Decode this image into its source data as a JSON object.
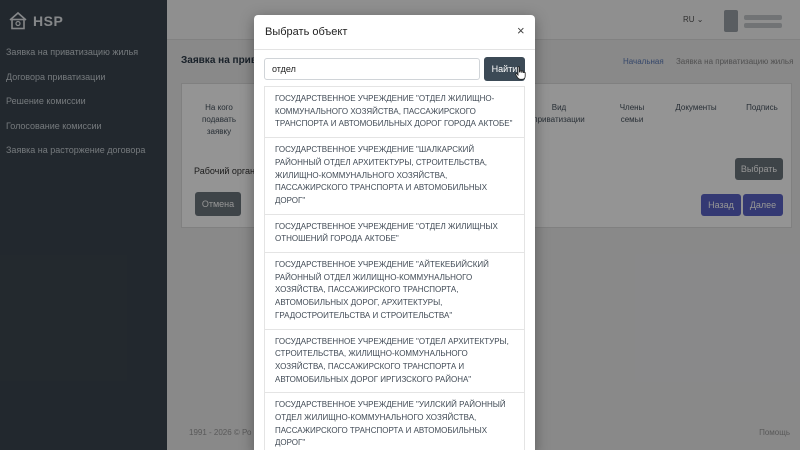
{
  "app": {
    "name": "HSP"
  },
  "sidebar": {
    "items": [
      {
        "label": "Заявка на приватизацию жилья"
      },
      {
        "label": "Договора приватизации"
      },
      {
        "label": "Решение комиссии"
      },
      {
        "label": "Голосование комиссии"
      },
      {
        "label": "Заявка на расторжение договора"
      }
    ]
  },
  "topbar": {
    "language": "RU"
  },
  "page": {
    "title": "Заявка на прива",
    "breadcrumb": {
      "home": "Начальная",
      "current": "Заявка на приватизацию жилья"
    },
    "columns": [
      {
        "label": "На кого подавать заявку"
      },
      {
        "label": "Вид приватизации"
      },
      {
        "label": "Члены семьи"
      },
      {
        "label": "Документы"
      },
      {
        "label": "Подпись"
      }
    ],
    "working_body_label": "Рабочий орган",
    "choose_label": "Выбрать",
    "cancel_label": "Отмена",
    "back_label": "Назад",
    "next_label": "Далее",
    "footer_left": "1991 - 2026 © Ро",
    "footer_right": "Помощь"
  },
  "modal": {
    "title": "Выбрать объект",
    "close_symbol": "×",
    "search": {
      "value": "отдел",
      "button_label": "Найти"
    },
    "results": [
      {
        "text": "ГОСУДАРСТВЕННОЕ УЧРЕЖДЕНИЕ \"ОТДЕЛ ЖИЛИЩНО-КОММУНАЛЬНОГО ХОЗЯЙСТВА, ПАССАЖИРСКОГО ТРАНСПОРТА И АВТОМОБИЛЬНЫХ ДОРОГ ГОРОДА АКТОБЕ\""
      },
      {
        "text": "ГОСУДАРСТВЕННОЕ УЧРЕЖДЕНИЕ \"ШАЛКАРСКИЙ РАЙОННЫЙ ОТДЕЛ АРХИТЕКТУРЫ, СТРОИТЕЛЬСТВА, ЖИЛИЩНО-КОММУНАЛЬНОГО ХОЗЯЙСТВА, ПАССАЖИРСКОГО ТРАНСПОРТА И АВТОМОБИЛЬНЫХ ДОРОГ\""
      },
      {
        "text": "ГОСУДАРСТВЕННОЕ УЧРЕЖДЕНИЕ \"ОТДЕЛ ЖИЛИЩНЫХ ОТНОШЕНИЙ ГОРОДА АКТОБЕ\""
      },
      {
        "text": "ГОСУДАРСТВЕННОЕ УЧРЕЖДЕНИЕ \"АЙТЕКЕБИЙСКИЙ РАЙОННЫЙ ОТДЕЛ ЖИЛИЩНО-КОММУНАЛЬНОГО ХОЗЯЙСТВА, ПАССАЖИРСКОГО ТРАНСПОРТА, АВТОМОБИЛЬНЫХ ДОРОГ, АРХИТЕКТУРЫ, ГРАДОСТРОИТЕЛЬСТВА И СТРОИТЕЛЬСТВА\""
      },
      {
        "text": "ГОСУДАРСТВЕННОЕ УЧРЕЖДЕНИЕ \"ОТДЕЛ АРХИТЕКТУРЫ, СТРОИТЕЛЬСТВА, ЖИЛИЩНО-КОММУНАЛЬНОГО ХОЗЯЙСТВА, ПАССАЖИРСКОГО ТРАНСПОРТА И АВТОМОБИЛЬНЫХ ДОРОГ ИРГИЗСКОГО РАЙОНА\""
      },
      {
        "text": "ГОСУДАРСТВЕННОЕ УЧРЕЖДЕНИЕ \"УИЛСКИЙ РАЙОННЫЙ ОТДЕЛ ЖИЛИЩНО-КОММУНАЛЬНОГО ХОЗЯЙСТВА, ПАССАЖИРСКОГО ТРАНСПОРТА И АВТОМОБИЛЬНЫХ ДОРОГ\""
      }
    ]
  },
  "colors": {
    "sidebar": "#3c4650",
    "primary_button": "#5a63c6",
    "search_button": "#3c4a56",
    "secondary_button": "#6c757d"
  },
  "icons": {
    "logo": "house-logo-icon",
    "close": "close-icon",
    "cursor": "hand-pointer-icon"
  }
}
